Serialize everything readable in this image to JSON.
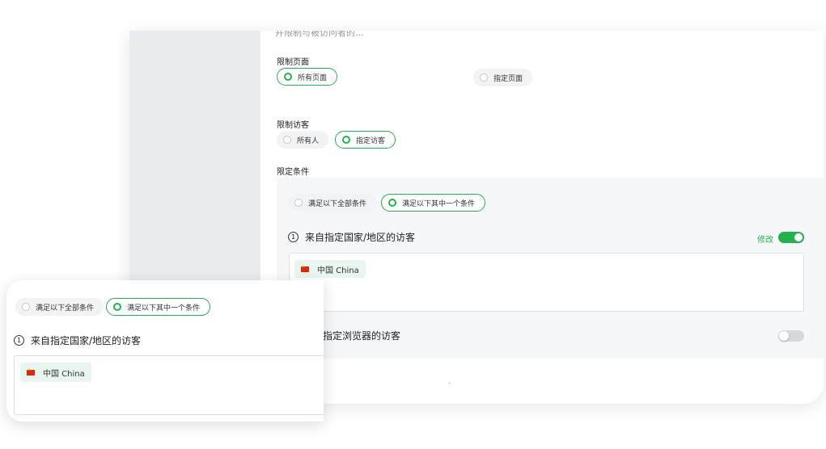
{
  "top_cut_text": "并限制与被访问者的...",
  "restrict_page": {
    "label": "限制页面",
    "options": [
      {
        "label": "所有页面",
        "selected": true
      },
      {
        "label": "指定页面",
        "selected": false
      }
    ]
  },
  "restrict_visitor": {
    "label": "限制访客",
    "options": [
      {
        "label": "所有人",
        "selected": false
      },
      {
        "label": "指定访客",
        "selected": true
      }
    ]
  },
  "conditions": {
    "label": "限定条件",
    "match_options": [
      {
        "label": "满足以下全部条件",
        "selected": false
      },
      {
        "label": "满足以下其中一个条件",
        "selected": true
      }
    ],
    "rule1": {
      "number": "1",
      "title": "来自指定国家/地区的访客",
      "edit_label": "修改",
      "enabled": true,
      "tags": [
        {
          "flag_icon": "china-flag-icon",
          "label": "中国  China"
        }
      ]
    },
    "rule2": {
      "title": "指定浏览器的访客",
      "enabled": false
    }
  },
  "bottom_cut_text": "·",
  "colors": {
    "accent": "#22b14c",
    "panel_bg": "#e9ecef",
    "condition_bg": "#f6f7f9",
    "tag_bg": "#e9f6ef"
  }
}
